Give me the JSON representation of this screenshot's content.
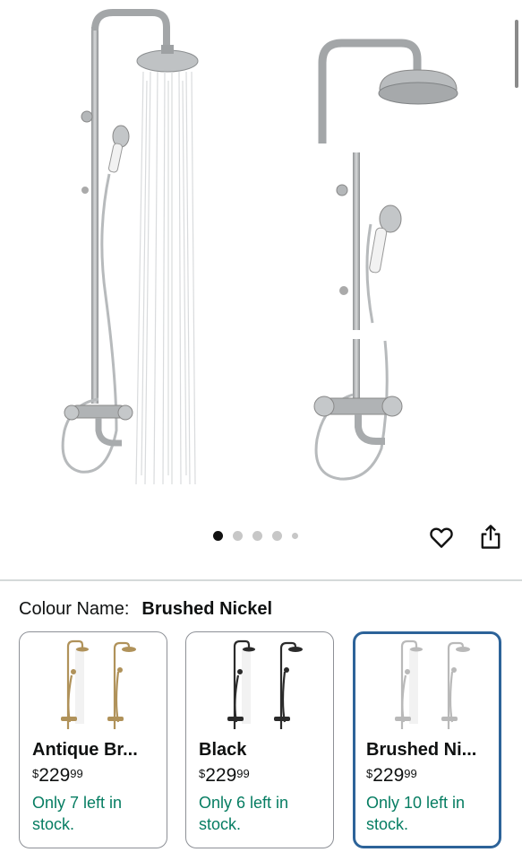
{
  "gallery": {
    "dots": 5,
    "active_dot": 1
  },
  "icons": {
    "wishlist": "heart-icon",
    "share": "share-icon"
  },
  "colour": {
    "label": "Colour Name:",
    "selected": "Brushed Nickel"
  },
  "variants": [
    {
      "name": "Antique Br...",
      "price_symbol": "$",
      "price_whole": "229",
      "price_fraction": "99",
      "stock": "Only 7 left in stock.",
      "finish_color": "#b0925a"
    },
    {
      "name": "Black",
      "price_symbol": "$",
      "price_whole": "229",
      "price_fraction": "99",
      "stock": "Only 6 left in stock.",
      "finish_color": "#2b2b2b"
    },
    {
      "name": "Brushed Ni...",
      "price_symbol": "$",
      "price_whole": "229",
      "price_fraction": "99",
      "stock": "Only 10 left in stock.",
      "finish_color": "#b9b9b9"
    }
  ],
  "colors": {
    "selected_border": "#2d6399",
    "stock_text": "#067d62",
    "nickel": "#a9acae"
  }
}
